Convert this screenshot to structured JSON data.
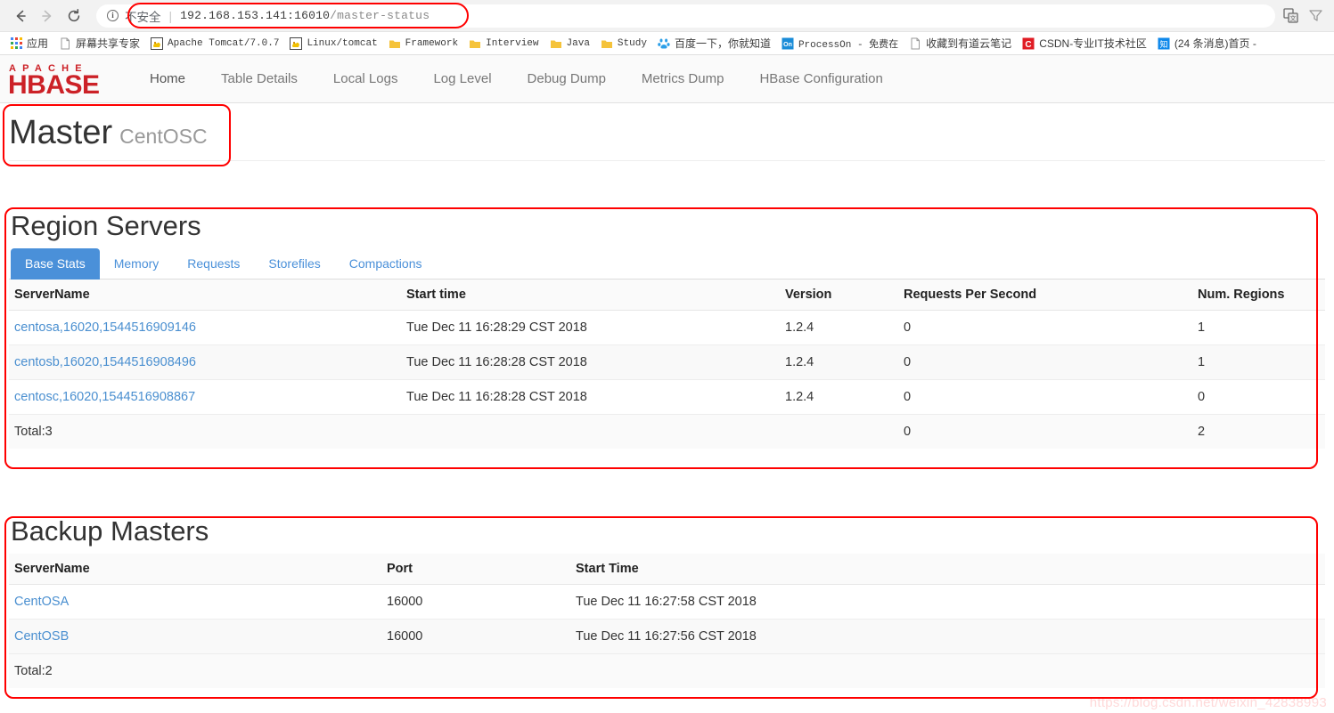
{
  "browser": {
    "back_icon": "back-arrow-icon",
    "forward_icon": "forward-arrow-icon",
    "reload_icon": "reload-icon",
    "security_label": "不安全",
    "url_host": "192.168.153.141:16010",
    "url_path": "/master-status",
    "url_full": "192.168.153.141:16010/master-status",
    "right_icons": [
      "translate-icon",
      "extension-icon"
    ],
    "bookmarks": [
      {
        "label": "应用",
        "icon": "apps-grid-icon"
      },
      {
        "label": "屏幕共享专家",
        "icon": "page-icon"
      },
      {
        "label": "Apache Tomcat/7.0.7",
        "icon": "tomcat-icon",
        "mono": true
      },
      {
        "label": "Linux/tomcat",
        "icon": "tomcat-icon",
        "mono": true
      },
      {
        "label": "Framework",
        "icon": "folder-icon",
        "mono": true
      },
      {
        "label": "Interview",
        "icon": "folder-icon",
        "mono": true
      },
      {
        "label": "Java",
        "icon": "folder-icon",
        "mono": true
      },
      {
        "label": "Study",
        "icon": "folder-icon",
        "mono": true
      },
      {
        "label": "百度一下，你就知道",
        "icon": "baidu-icon"
      },
      {
        "label": "ProcessOn - 免费在",
        "icon": "processon-icon",
        "mono": true
      },
      {
        "label": "收藏到有道云笔记",
        "icon": "page-icon"
      },
      {
        "label": "CSDN-专业IT技术社区",
        "icon": "csdn-icon"
      },
      {
        "label": "(24 条消息)首页 -",
        "icon": "zhihu-icon"
      }
    ]
  },
  "navbar": {
    "brand": "APACHE HBASE",
    "links": [
      {
        "label": "Home",
        "active": true
      },
      {
        "label": "Table Details",
        "active": false
      },
      {
        "label": "Local Logs",
        "active": false
      },
      {
        "label": "Log Level",
        "active": false
      },
      {
        "label": "Debug Dump",
        "active": false
      },
      {
        "label": "Metrics Dump",
        "active": false
      },
      {
        "label": "HBase Configuration",
        "active": false
      }
    ]
  },
  "master": {
    "title": "Master",
    "hostname": "CentOSC"
  },
  "region_servers": {
    "heading": "Region Servers",
    "tabs": [
      {
        "label": "Base Stats",
        "active": true
      },
      {
        "label": "Memory",
        "active": false
      },
      {
        "label": "Requests",
        "active": false
      },
      {
        "label": "Storefiles",
        "active": false
      },
      {
        "label": "Compactions",
        "active": false
      }
    ],
    "columns": [
      "ServerName",
      "Start time",
      "Version",
      "Requests Per Second",
      "Num. Regions"
    ],
    "rows": [
      {
        "server_name": "centosa,16020,1544516909146",
        "start_time": "Tue Dec 11 16:28:29 CST 2018",
        "version": "1.2.4",
        "requests_per_second": "0",
        "num_regions": "1"
      },
      {
        "server_name": "centosb,16020,1544516908496",
        "start_time": "Tue Dec 11 16:28:28 CST 2018",
        "version": "1.2.4",
        "requests_per_second": "0",
        "num_regions": "1"
      },
      {
        "server_name": "centosc,16020,1544516908867",
        "start_time": "Tue Dec 11 16:28:28 CST 2018",
        "version": "1.2.4",
        "requests_per_second": "0",
        "num_regions": "0"
      }
    ],
    "total": {
      "label": "Total:3",
      "start_time": "",
      "version": "",
      "requests_per_second": "0",
      "num_regions": "2"
    }
  },
  "backup_masters": {
    "heading": "Backup Masters",
    "columns": [
      "ServerName",
      "Port",
      "Start Time"
    ],
    "rows": [
      {
        "server_name": "CentOSA",
        "port": "16000",
        "start_time": "Tue Dec 11 16:27:58 CST 2018"
      },
      {
        "server_name": "CentOSB",
        "port": "16000",
        "start_time": "Tue Dec 11 16:27:56 CST 2018"
      }
    ],
    "total": {
      "label": "Total:2",
      "port": "",
      "start_time": ""
    }
  },
  "watermark": "https://blog.csdn.net/weixin_42838993",
  "colors": {
    "accent_blue": "#4a90d9",
    "link_blue": "#4a8fd0",
    "annotation_red": "#ff0000",
    "hbase_red": "#cc2127"
  }
}
